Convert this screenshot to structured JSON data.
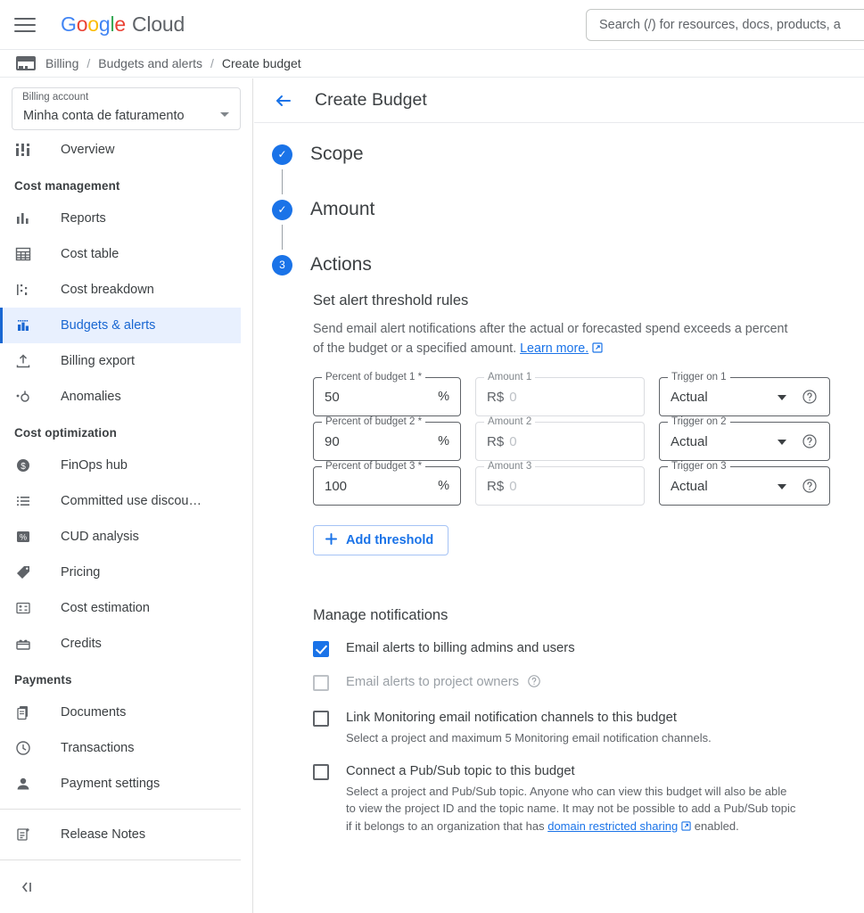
{
  "topbar": {
    "menu_icon": "hamburger-icon",
    "logo": {
      "g": "G",
      "o1": "o",
      "o2": "o",
      "g_small": "g",
      "l": "l",
      "e": "e",
      "word": "Cloud"
    },
    "search_placeholder": "Search (/) for resources, docs, products, a"
  },
  "breadcrumb": {
    "icon": "credit-card-icon",
    "items": [
      "Billing",
      "Budgets and alerts",
      "Create budget"
    ],
    "separator": "/"
  },
  "sidebar": {
    "account": {
      "label": "Billing account",
      "value": "Minha conta de faturamento",
      "caret_icon": "chevron-down-icon"
    },
    "overview": {
      "label": "Overview",
      "icon": "overview-icon"
    },
    "groups": [
      {
        "label": "Cost management",
        "items": [
          {
            "label": "Reports",
            "icon": "bar-chart-icon",
            "active": false
          },
          {
            "label": "Cost table",
            "icon": "table-icon",
            "active": false
          },
          {
            "label": "Cost breakdown",
            "icon": "waterfall-icon",
            "active": false
          },
          {
            "label": "Budgets & alerts",
            "icon": "budget-icon",
            "active": true
          },
          {
            "label": "Billing export",
            "icon": "export-icon",
            "active": false
          },
          {
            "label": "Anomalies",
            "icon": "anomalies-icon",
            "active": false
          }
        ]
      },
      {
        "label": "Cost optimization",
        "items": [
          {
            "label": "FinOps hub",
            "icon": "dollar-circle-icon",
            "active": false
          },
          {
            "label": "Committed use discou…",
            "icon": "list-icon",
            "active": false
          },
          {
            "label": "CUD analysis",
            "icon": "percent-icon",
            "active": false
          },
          {
            "label": "Pricing",
            "icon": "tag-icon",
            "active": false
          },
          {
            "label": "Cost estimation",
            "icon": "estimate-icon",
            "active": false
          },
          {
            "label": "Credits",
            "icon": "credits-icon",
            "active": false
          }
        ]
      },
      {
        "label": "Payments",
        "items": [
          {
            "label": "Documents",
            "icon": "documents-icon",
            "active": false
          },
          {
            "label": "Transactions",
            "icon": "clock-icon",
            "active": false
          },
          {
            "label": "Payment settings",
            "icon": "person-icon",
            "active": false
          }
        ]
      }
    ],
    "release_notes": {
      "label": "Release Notes",
      "icon": "release-notes-icon"
    },
    "collapse": {
      "label": "",
      "icon": "collapse-panel-icon"
    }
  },
  "page": {
    "back_icon": "back-arrow-icon",
    "title": "Create Budget",
    "steps": [
      {
        "label": "Scope",
        "marker": "✓",
        "state": "done"
      },
      {
        "label": "Amount",
        "marker": "✓",
        "state": "done"
      },
      {
        "label": "Actions",
        "marker": "3",
        "state": "current"
      }
    ]
  },
  "alerts": {
    "title": "Set alert threshold rules",
    "description": "Send email alert notifications after the actual or forecasted spend exceeds a percent of the budget or a specified amount.",
    "learn_more": "Learn more.",
    "thresholds": [
      {
        "percent_label": "Percent of budget 1 *",
        "percent_value": "50",
        "percent_suffix": "%",
        "amount_label": "Amount 1",
        "amount_prefix": "R$",
        "amount_placeholder": "0",
        "trigger_label": "Trigger on 1",
        "trigger_value": "Actual"
      },
      {
        "percent_label": "Percent of budget 2 *",
        "percent_value": "90",
        "percent_suffix": "%",
        "amount_label": "Amount 2",
        "amount_prefix": "R$",
        "amount_placeholder": "0",
        "trigger_label": "Trigger on 2",
        "trigger_value": "Actual"
      },
      {
        "percent_label": "Percent of budget 3 *",
        "percent_value": "100",
        "percent_suffix": "%",
        "amount_label": "Amount 3",
        "amount_prefix": "R$",
        "amount_placeholder": "0",
        "trigger_label": "Trigger on 3",
        "trigger_value": "Actual"
      }
    ],
    "add_threshold": "Add threshold",
    "add_icon": "plus-icon"
  },
  "notifications": {
    "title": "Manage notifications",
    "options": [
      {
        "label": "Email alerts to billing admins and users",
        "checked": true,
        "disabled": false,
        "sub": "",
        "help": false
      },
      {
        "label": "Email alerts to project owners",
        "checked": false,
        "disabled": true,
        "sub": "",
        "help": true
      },
      {
        "label": "Link Monitoring email notification channels to this budget",
        "checked": false,
        "disabled": false,
        "sub": "Select a project and maximum 5 Monitoring email notification channels.",
        "help": false
      },
      {
        "label": "Connect a Pub/Sub topic to this budget",
        "checked": false,
        "disabled": false,
        "sub_parts": {
          "before": "Select a project and Pub/Sub topic. Anyone who can view this budget will also be able to view the project ID and the topic name. It may not be possible to add a Pub/Sub topic if it belongs to an organization that has ",
          "link": "domain restricted sharing",
          "after": " enabled."
        },
        "help": false
      }
    ]
  },
  "colors": {
    "accent": "#1a73e8",
    "active_bg": "#e8f0fe",
    "active_text": "#1967d2",
    "text": "#3c4043",
    "muted": "#5f6368",
    "disabled": "#9aa0a6",
    "border": "#dadce0"
  }
}
